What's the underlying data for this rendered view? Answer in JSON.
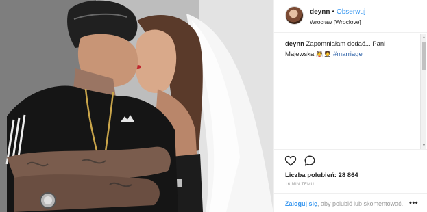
{
  "post": {
    "image_alt": "Photo"
  },
  "header": {
    "username": "deynn",
    "separator": "•",
    "follow_label": "Obserwuj",
    "location": "Wrocław [Wroclove]"
  },
  "caption": {
    "username": "deynn",
    "text": "Zapomniałam dodać... Pani Majewska",
    "emoji": "👰🤵",
    "hashtag": "#marriage"
  },
  "actions": {
    "likes_label": "Liczba polubień:",
    "likes_count": "28 864",
    "time_ago": "16 MIN TEMU"
  },
  "login": {
    "link_label": "Zaloguj się",
    "rest_text": ", aby polubić lub skomentować.",
    "more_label": "•••"
  },
  "icons": {
    "like": "heart-icon",
    "comment": "comment-icon",
    "more": "more-options-icon"
  },
  "colors": {
    "link_blue": "#3897f0",
    "text": "#262626",
    "muted": "#999999",
    "border": "#efefef"
  }
}
